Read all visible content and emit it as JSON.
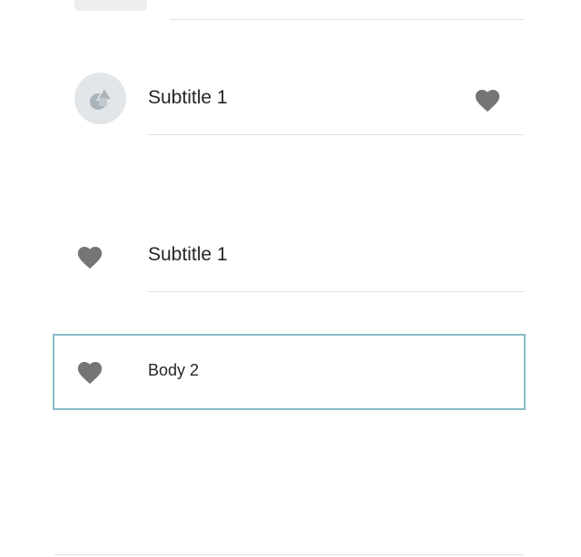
{
  "list": {
    "items": [
      {
        "type": "avatar-subtitle",
        "label": "Subtitle 1",
        "avatar_icon": "shapes-icon",
        "trailing_icon": "heart-icon"
      },
      {
        "type": "icon-subtitle",
        "label": "Subtitle 1",
        "leading_icon": "heart-icon"
      },
      {
        "type": "icon-body",
        "label": "Body 2",
        "leading_icon": "heart-icon",
        "focused": true
      }
    ]
  },
  "colors": {
    "icon": "#757575",
    "text": "#262626",
    "divider": "#e0e0e0",
    "avatar_bg": "#e3e6e8",
    "avatar_shapes": "#a9b4bb",
    "focus_outline": "#86bcc6"
  }
}
